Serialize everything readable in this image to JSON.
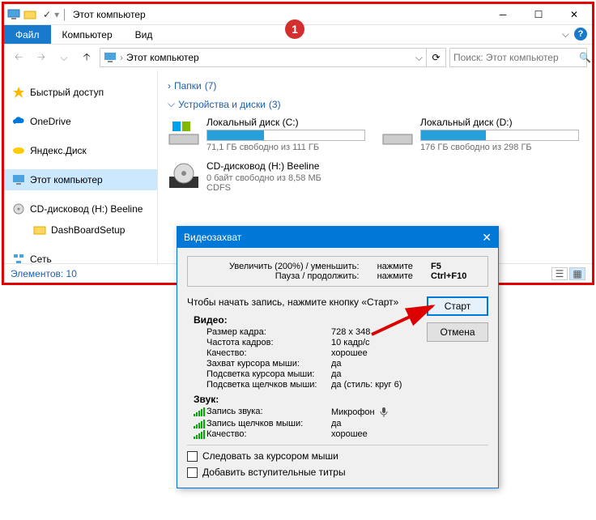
{
  "window": {
    "title": "Этот компьютер",
    "qat_check": "✓"
  },
  "ribbon": {
    "file": "Файл",
    "computer": "Компьютер",
    "view": "Вид"
  },
  "addr": {
    "path": "Этот компьютер",
    "search_placeholder": "Поиск: Этот компьютер"
  },
  "sidebar": {
    "items": [
      {
        "label": "Быстрый доступ",
        "icon": "star"
      },
      {
        "label": "OneDrive",
        "icon": "cloud"
      },
      {
        "label": "Яндекс.Диск",
        "icon": "yadisk"
      },
      {
        "label": "Этот компьютер",
        "icon": "pc",
        "selected": true
      },
      {
        "label": "CD-дисковод (H:) Beeline",
        "icon": "cd"
      },
      {
        "label": "DashBoardSetup",
        "icon": "folder",
        "indent": true
      },
      {
        "label": "Сеть",
        "icon": "net"
      }
    ]
  },
  "groups": {
    "folders": {
      "label": "Папки",
      "count": "(7)"
    },
    "devices": {
      "label": "Устройства и диски",
      "count": "(3)"
    }
  },
  "drives": [
    {
      "name": "Локальный диск (C:)",
      "info": "71,1 ГБ свободно из 111 ГБ",
      "fill": 36
    },
    {
      "name": "Локальный диск (D:)",
      "info": "176 ГБ свободно из 298 ГБ",
      "fill": 41
    }
  ],
  "cd": {
    "name": "CD-дисковод (H:) Beeline",
    "info1": "0 байт свободно из 8,58 МБ",
    "info2": "CDFS"
  },
  "status": {
    "text": "Элементов: 10"
  },
  "annotation": "1",
  "dialog": {
    "title": "Видеозахват",
    "hint1_label": "Увеличить (200%) / уменьшить:",
    "hint1_action": "нажмите",
    "hint1_key": "F5",
    "hint2_label": "Пауза / продолжить:",
    "hint2_action": "нажмите",
    "hint2_key": "Ctrl+F10",
    "instruction": "Чтобы начать запись, нажмите кнопку «Старт»",
    "btn_start": "Старт",
    "btn_cancel": "Отмена",
    "video_label": "Видео:",
    "audio_label": "Звук:",
    "props": [
      {
        "name": "Размер кадра:",
        "val": "728 x 348"
      },
      {
        "name": "Частота кадров:",
        "val": "10 кадр/с"
      },
      {
        "name": "Качество:",
        "val": "хорошее"
      },
      {
        "name": "Захват курсора мыши:",
        "val": "да"
      },
      {
        "name": "Подсветка курсора мыши:",
        "val": "да"
      },
      {
        "name": "Подсветка щелчков мыши:",
        "val": "да  (стиль: круг 6)"
      }
    ],
    "audio": [
      {
        "name": "Запись звука:",
        "val": "Микрофон",
        "mic": true
      },
      {
        "name": "Запись щелчков мыши:",
        "val": "да"
      },
      {
        "name": "Качество:",
        "val": "хорошее"
      }
    ],
    "chk1": "Следовать за курсором мыши",
    "chk2": "Добавить вступительные титры"
  }
}
